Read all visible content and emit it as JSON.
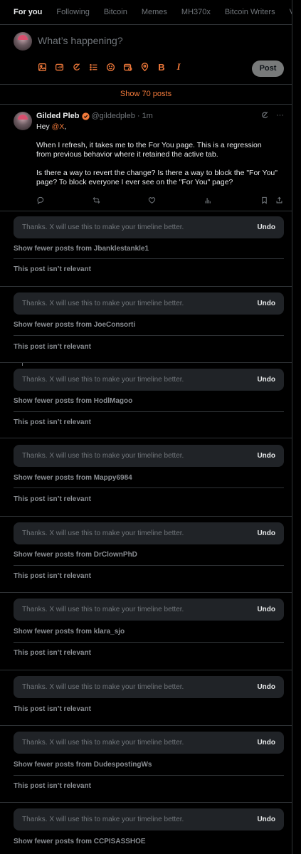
{
  "tabs": [
    {
      "label": "For you",
      "active": true
    },
    {
      "label": "Following",
      "active": false
    },
    {
      "label": "Bitcoin",
      "active": false
    },
    {
      "label": "Memes",
      "active": false
    },
    {
      "label": "MH370x",
      "active": false
    },
    {
      "label": "Bitcoin Writers",
      "active": false
    },
    {
      "label": "V",
      "active": false
    }
  ],
  "composer": {
    "placeholder": "What’s happening?",
    "tools": [
      "image-icon",
      "gif-icon",
      "grok-icon",
      "poll-icon",
      "emoji-icon",
      "schedule-icon",
      "location-icon",
      "bold-icon",
      "italic-icon"
    ],
    "bold_label": "B",
    "italic_label": "I",
    "post_label": "Post"
  },
  "show_posts": "Show 70 posts",
  "tweet": {
    "name": "Gilded Pleb",
    "handle": "@gildedpleb",
    "dot": "·",
    "time": "1m",
    "more": "···",
    "greeting_prefix": "Hey ",
    "mention": "@X",
    "greeting_suffix": ",",
    "para1": "When I refresh, it takes me to the For You page. This is a regression from previous behavior where it retained the active tab.",
    "para2": "Is there a way to revert the change? Is there a way to block the \"For You\" page? To block everyone I ever see on the \"For You\" page?"
  },
  "accent_color": "#f0793a",
  "feedback_message": "Thanks. X will use this to make your timeline better.",
  "undo_label": "Undo",
  "feedback": [
    {
      "show_fewer": "Show fewer posts from Jbanklestankle1",
      "not_relevant": "This post isn’t relevant"
    },
    {
      "show_fewer": "Show fewer posts from JoeConsorti",
      "not_relevant": "This post isn’t relevant"
    },
    {
      "show_fewer": "Show fewer posts from HodlMagoo",
      "not_relevant": "This post isn’t relevant"
    },
    {
      "show_fewer": "Show fewer posts from Mappy6984",
      "not_relevant": "This post isn’t relevant"
    },
    {
      "show_fewer": "Show fewer posts from DrClownPhD",
      "not_relevant": "This post isn’t relevant"
    },
    {
      "show_fewer": "Show fewer posts from klara_sjo",
      "not_relevant": "This post isn’t relevant"
    },
    {
      "show_fewer": "",
      "not_relevant": "This post isn’t relevant"
    },
    {
      "show_fewer": "Show fewer posts from DudespostingWs",
      "not_relevant": "This post isn’t relevant"
    },
    {
      "show_fewer": "Show fewer posts from CCPISASSHOE",
      "not_relevant": ""
    }
  ]
}
